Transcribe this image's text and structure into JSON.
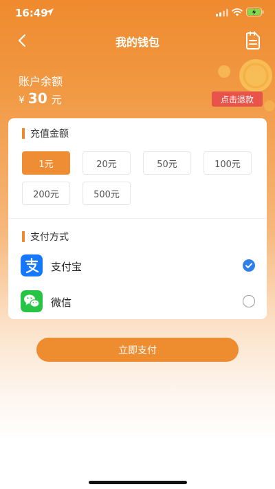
{
  "status_bar": {
    "time": "16:49"
  },
  "nav": {
    "title": "我的钱包",
    "back_icon": "chevron-left-icon",
    "records_icon": "document-icon"
  },
  "balance": {
    "label": "账户余额",
    "currency": "¥",
    "amount": "30",
    "unit": "元",
    "refund_label": "点击退款"
  },
  "recharge": {
    "title": "充值金额",
    "options": [
      "1元",
      "20元",
      "50元",
      "100元",
      "200元",
      "500元"
    ],
    "selected_index": 0
  },
  "payment": {
    "title": "支付方式",
    "methods": [
      {
        "label": "支付宝",
        "icon": "alipay-icon",
        "selected": true
      },
      {
        "label": "微信",
        "icon": "wechat-icon",
        "selected": false
      }
    ]
  },
  "actions": {
    "pay_now": "立即支付"
  },
  "colors": {
    "accent": "#ef8d34",
    "refund": "#e8534a",
    "alipay": "#1678ff",
    "wechat": "#28c445",
    "radio_checked": "#2f80ed"
  }
}
